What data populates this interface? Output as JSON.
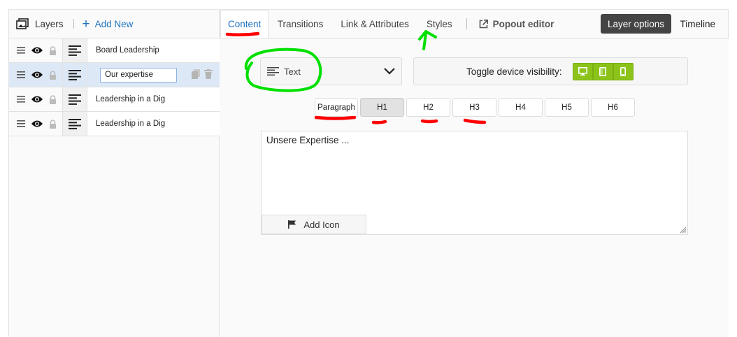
{
  "layers_panel": {
    "title": "Layers",
    "add_new": "Add New",
    "rows": [
      {
        "name": "Board Leadership",
        "active": false
      },
      {
        "name": "Our expertise",
        "active": true
      },
      {
        "name": "Leadership in a Dig",
        "active": false
      },
      {
        "name": "Leadership in a Dig",
        "active": false
      }
    ]
  },
  "tabs": {
    "content": "Content",
    "transitions": "Transitions",
    "link_attributes": "Link & Attributes",
    "styles": "Styles",
    "popout": "Popout editor",
    "layer_options": "Layer options",
    "timeline": "Timeline"
  },
  "layer_type": {
    "selected": "Text"
  },
  "visibility": {
    "label": "Toggle device visibility:",
    "devices": [
      "desktop",
      "tablet",
      "mobile"
    ],
    "active_color": "#8bc31b"
  },
  "tags": {
    "paragraph": "Paragraph",
    "headings": [
      "H1",
      "H2",
      "H3",
      "H4",
      "H5",
      "H6"
    ],
    "selected": "H1"
  },
  "editor": {
    "text": "Unsere Expertise ...",
    "add_icon": "Add Icon"
  },
  "colors": {
    "accent": "#1e73be",
    "annotation_red": "#ff0000",
    "annotation_green": "#00e000"
  }
}
